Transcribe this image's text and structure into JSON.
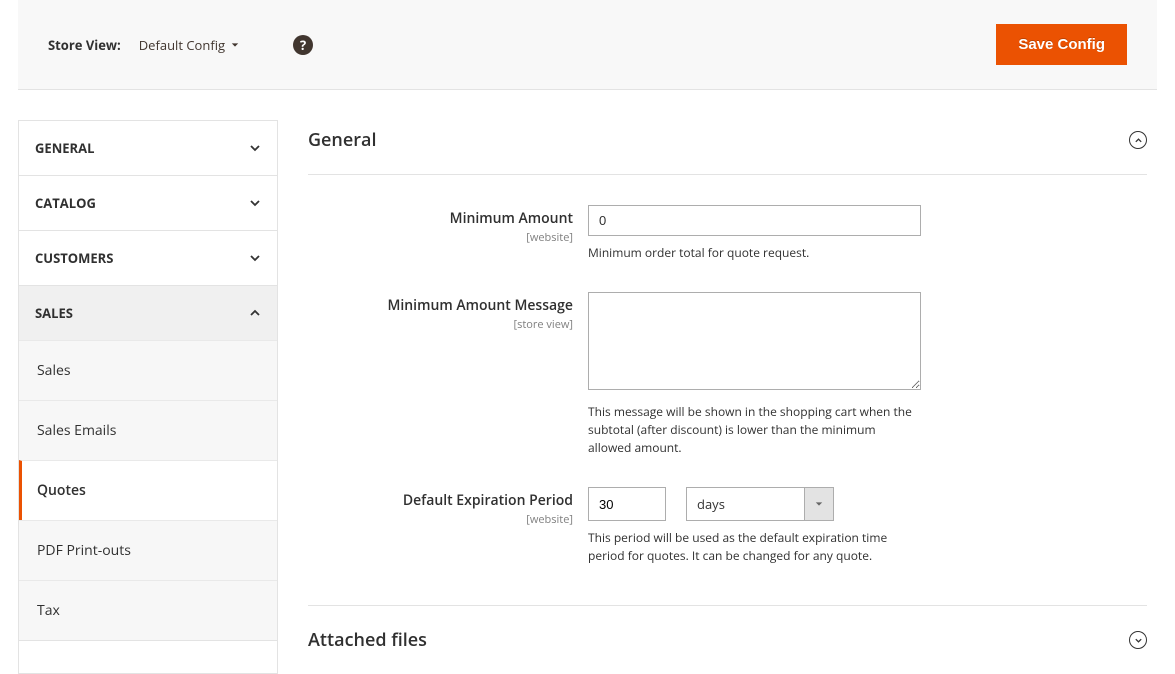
{
  "topbar": {
    "store_view_label": "Store View:",
    "store_view_value": "Default Config",
    "save_button": "Save Config"
  },
  "sidebar": {
    "groups": [
      {
        "label": "GENERAL",
        "expanded": false,
        "items": []
      },
      {
        "label": "CATALOG",
        "expanded": false,
        "items": []
      },
      {
        "label": "CUSTOMERS",
        "expanded": false,
        "items": []
      },
      {
        "label": "SALES",
        "expanded": true,
        "items": [
          {
            "label": "Sales",
            "active": false
          },
          {
            "label": "Sales Emails",
            "active": false
          },
          {
            "label": "Quotes",
            "active": true
          },
          {
            "label": "PDF Print-outs",
            "active": false
          },
          {
            "label": "Tax",
            "active": false
          }
        ]
      }
    ]
  },
  "sections": {
    "general": {
      "title": "General",
      "expanded": true,
      "fields": {
        "min_amount": {
          "label": "Minimum Amount",
          "scope": "[website]",
          "value": "0",
          "hint": "Minimum order total for quote request."
        },
        "min_amount_msg": {
          "label": "Minimum Amount Message",
          "scope": "[store view]",
          "value": "",
          "hint": "This message will be shown in the shopping cart when the subtotal (after discount) is lower than the minimum allowed amount."
        },
        "expiration": {
          "label": "Default Expiration Period",
          "scope": "[website]",
          "value": "30",
          "unit": "days",
          "hint": "This period will be used as the default expiration time period for quotes. It can be changed for any quote."
        }
      }
    },
    "attached": {
      "title": "Attached files",
      "expanded": false
    }
  }
}
